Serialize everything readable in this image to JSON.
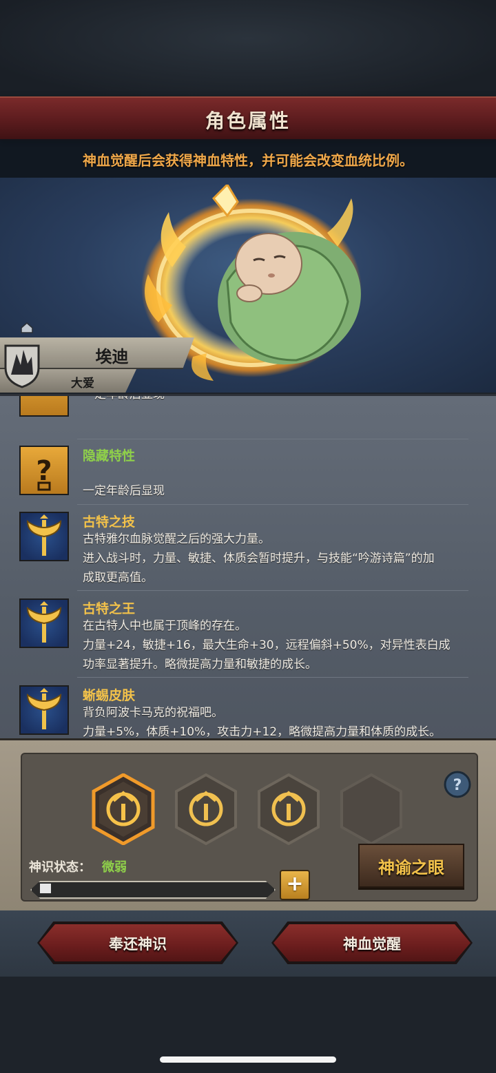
{
  "header": {
    "title": "角色属性"
  },
  "subtitle": "神血觉醒后会获得神血特性，并可能会改变血统比例。",
  "character": {
    "name": "埃迪",
    "title": "大爱"
  },
  "traits": [
    {
      "name": "",
      "desc": "一定年龄后显现",
      "icon": "question-icon"
    },
    {
      "name": "隐藏特性",
      "desc": "一定年龄后显现",
      "icon": "question-icon"
    },
    {
      "name": "古特之技",
      "desc_lines": [
        "古特雅尔血脉觉醒之后的强大力量。",
        "进入战斗时，力量、敏捷、体质会暂时提升，与技能“吟游诗篇”的加",
        "成取更高值。"
      ],
      "icon": "axe-icon"
    },
    {
      "name": "古特之王",
      "desc_lines": [
        "在古特人中也属于顶峰的存在。",
        "力量+24，敏捷+16，最大生命+30，远程偏斜+50%，对异性表白成",
        "功率显著提升。略微提高力量和敏捷的成长。"
      ],
      "icon": "axe-icon"
    },
    {
      "name": "蜥蜴皮肤",
      "desc_lines": [
        "背负阿波卡马克的祝福吧。",
        "力量+5%，体质+10%，攻击力+12，略微提高力量和体质的成长。"
      ],
      "icon": "axe-icon"
    }
  ],
  "awaken": {
    "divine_label": "神识状态：",
    "divine_value": "微弱",
    "progress": 0.05,
    "plus_label": "+",
    "oracle_button": "神谕之眼",
    "slots": [
      "filled-selected",
      "filled",
      "filled",
      "empty"
    ]
  },
  "buttons": {
    "return": "奉还神识",
    "awaken": "神血觉醒"
  },
  "colors": {
    "accent_gold": "#f3c24a",
    "accent_green": "#8fd04a",
    "banner_red": "#6a1d1d",
    "subtitle_orange": "#f0a84a"
  }
}
